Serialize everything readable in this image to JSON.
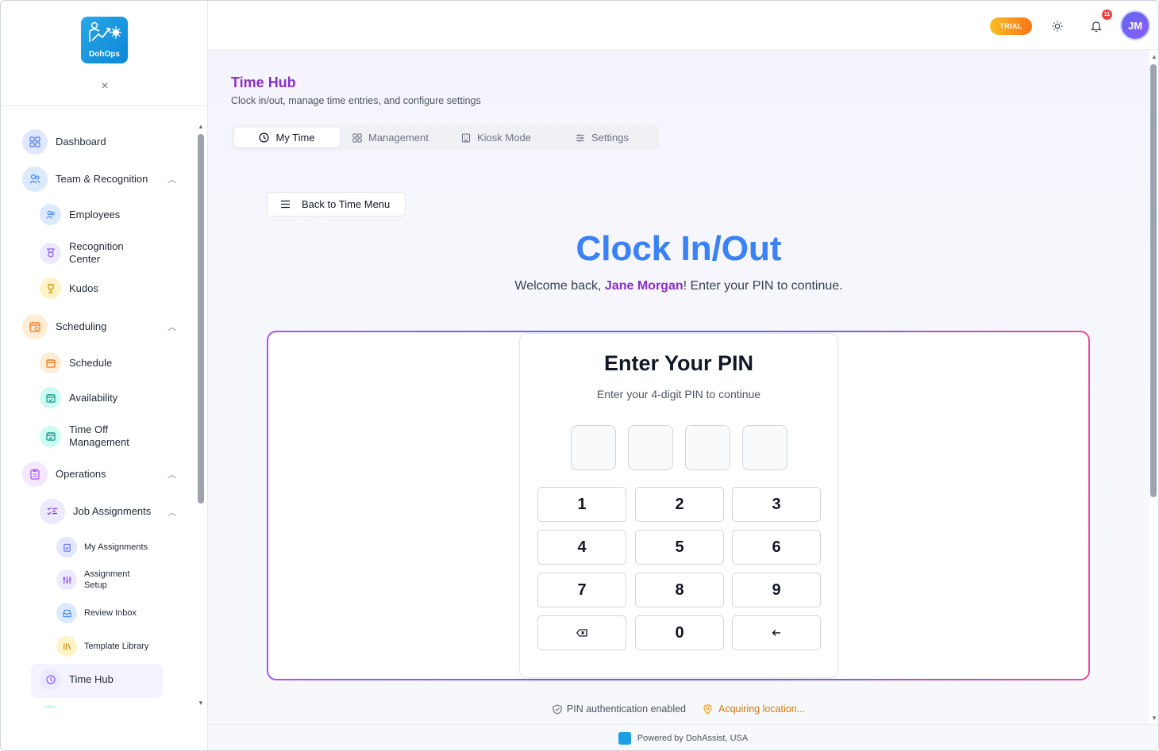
{
  "app": {
    "logo_text": "DohOps"
  },
  "sidebar": {
    "items": [
      {
        "label": "Dashboard"
      },
      {
        "label": "Team & Recognition"
      },
      {
        "label": "Employees"
      },
      {
        "label": "Recognition Center"
      },
      {
        "label": "Kudos"
      },
      {
        "label": "Scheduling"
      },
      {
        "label": "Schedule"
      },
      {
        "label": "Availability"
      },
      {
        "label": "Time Off Management"
      },
      {
        "label": "Operations"
      },
      {
        "label": "Job Assignments"
      },
      {
        "label": "My Assignments"
      },
      {
        "label": "Assignment Setup"
      },
      {
        "label": "Review Inbox"
      },
      {
        "label": "Template Library"
      },
      {
        "label": "Time Hub"
      }
    ]
  },
  "topbar": {
    "trial_label": "TRIAL",
    "notification_count": "11",
    "avatar_initials": "JM"
  },
  "page": {
    "title": "Time Hub",
    "subtitle": "Clock in/out, manage time entries, and configure settings",
    "tabs": [
      {
        "label": "My Time"
      },
      {
        "label": "Management"
      },
      {
        "label": "Kiosk Mode"
      },
      {
        "label": "Settings"
      }
    ],
    "back_label": "Back to Time Menu",
    "clock_title": "Clock In/Out",
    "welcome_prefix": "Welcome back, ",
    "user_name": "Jane Morgan",
    "welcome_suffix": "! Enter your PIN to continue."
  },
  "pin": {
    "title": "Enter Your PIN",
    "subtitle": "Enter your 4-digit PIN to continue",
    "keys": [
      "1",
      "2",
      "3",
      "4",
      "5",
      "6",
      "7",
      "8",
      "9",
      "0"
    ]
  },
  "status": {
    "auth": "PIN authentication enabled",
    "location": "Acquiring location..."
  },
  "footer": {
    "text": "Powered by DohAssist, USA"
  }
}
